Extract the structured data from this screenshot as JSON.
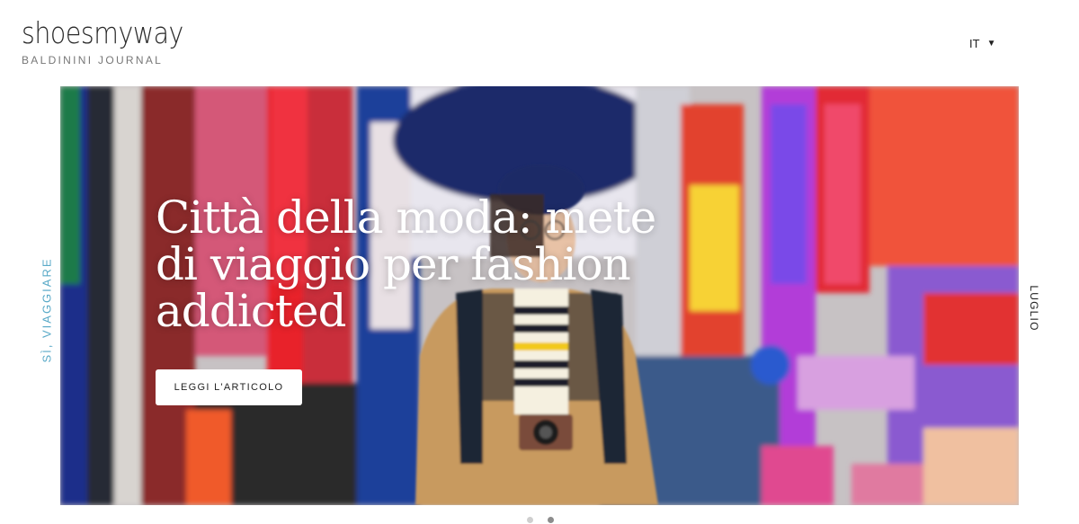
{
  "brand": {
    "title": "shoesmyway",
    "subtitle": "BALDININI JOURNAL"
  },
  "language": {
    "selected": "IT",
    "caret_icon": "chevron-down-icon"
  },
  "hero": {
    "category": "SÌ, VIAGGIARE",
    "title": "Città della moda: mete di viaggio per fashion addicted",
    "cta_label": "LEGGI L'ARTICOLO",
    "month": "LUGLIO",
    "image_description": "woman in beret and camel coat with camera on a colorful neon-sign street"
  },
  "carousel": {
    "slides": 2,
    "active_index": 1
  },
  "colors": {
    "category": "#5aaac8",
    "background": "#ffffff",
    "text": "#222222"
  }
}
